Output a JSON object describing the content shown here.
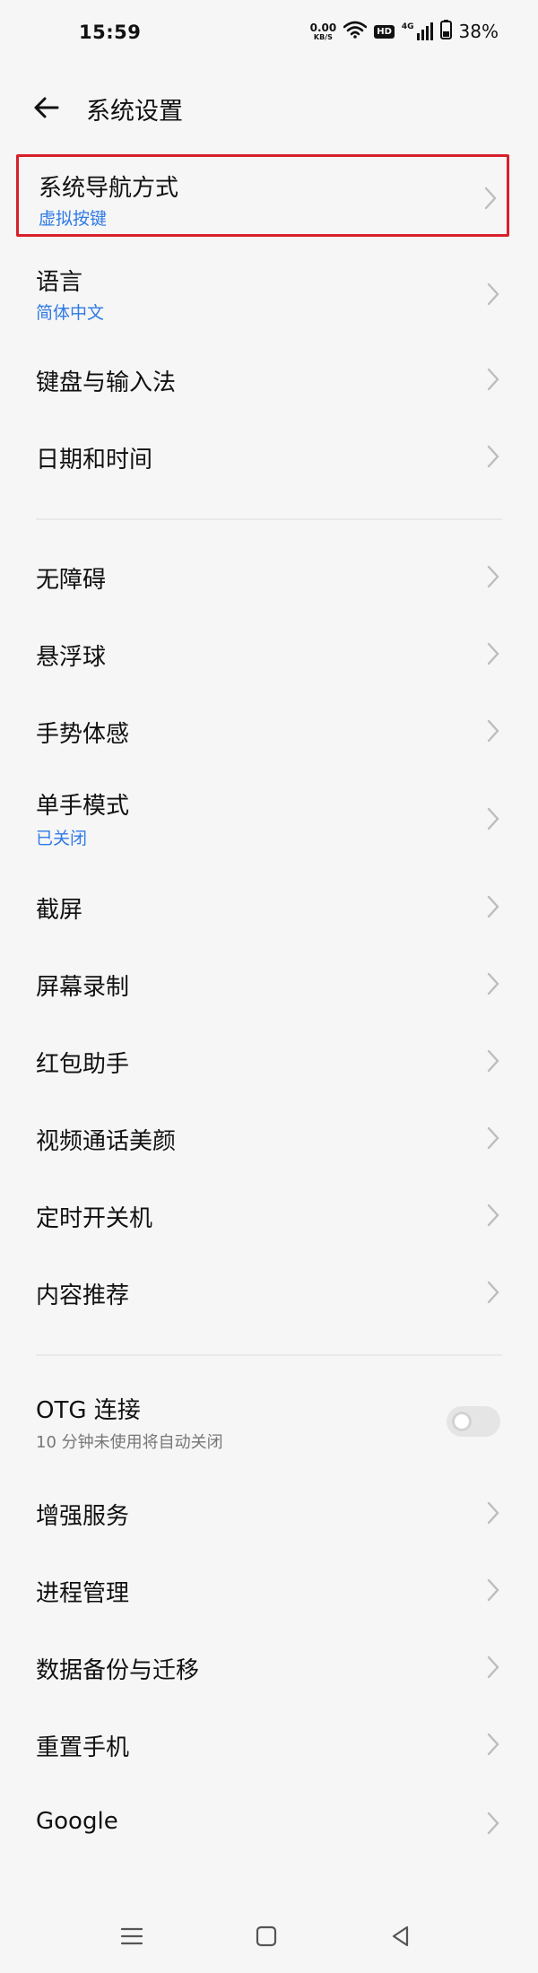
{
  "status_bar": {
    "time": "15:59",
    "speed_value": "0.00",
    "speed_unit": "KB/S",
    "hd_label": "HD",
    "network_label": "4G",
    "battery_percent": "38%",
    "icons": [
      "wifi-icon",
      "hd-icon",
      "signal-icon",
      "battery-icon"
    ]
  },
  "header": {
    "back_icon": "arrow-left-icon",
    "title": "系统设置"
  },
  "settings": {
    "group1": [
      {
        "label": "系统导航方式",
        "sub": "虚拟按键",
        "highlighted": true
      },
      {
        "label": "语言",
        "sub": "简体中文"
      },
      {
        "label": "键盘与输入法"
      },
      {
        "label": "日期和时间"
      }
    ],
    "group2": [
      {
        "label": "无障碍"
      },
      {
        "label": "悬浮球"
      },
      {
        "label": "手势体感"
      },
      {
        "label": "单手模式",
        "sub": "已关闭"
      },
      {
        "label": "截屏"
      },
      {
        "label": "屏幕录制"
      },
      {
        "label": "红包助手"
      },
      {
        "label": "视频通话美颜"
      },
      {
        "label": "定时开关机"
      },
      {
        "label": "内容推荐"
      }
    ],
    "group3": [
      {
        "label": "OTG 连接",
        "sub": "10 分钟未使用将自动关闭",
        "toggle": false
      },
      {
        "label": "增强服务"
      },
      {
        "label": "进程管理"
      },
      {
        "label": "数据备份与迁移"
      },
      {
        "label": "重置手机"
      },
      {
        "label": "Google"
      }
    ]
  },
  "nav_bar": {
    "icons": [
      "menu-icon",
      "home-icon",
      "back-icon"
    ]
  },
  "colors": {
    "background": "#f6f6f6",
    "subtitle_blue": "#2f7ae5",
    "highlight_red": "#d8202a"
  }
}
